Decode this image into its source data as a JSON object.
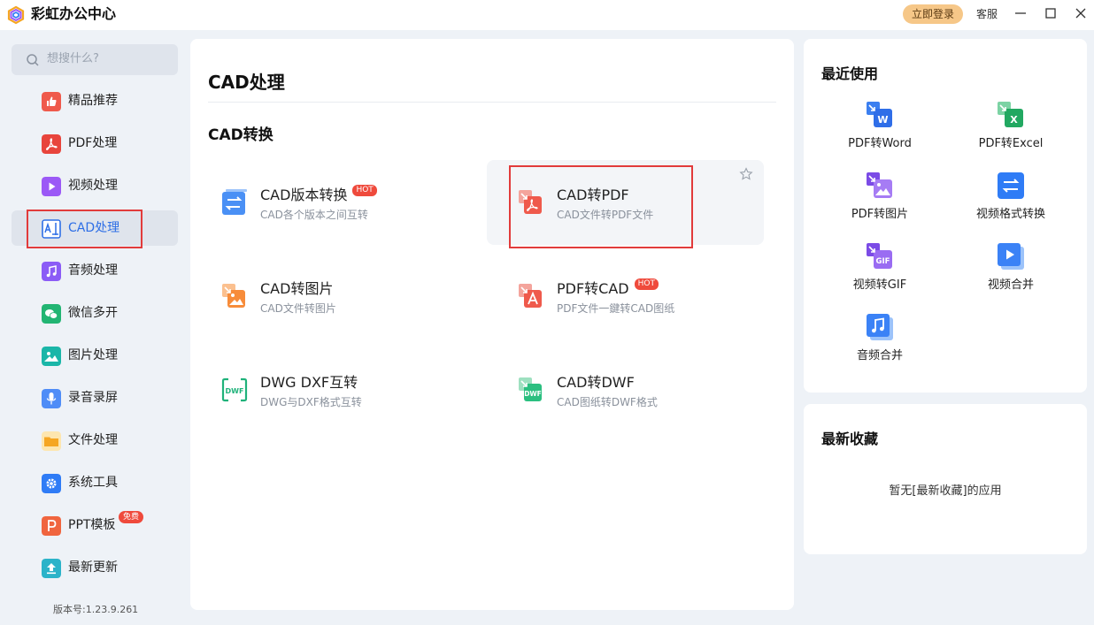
{
  "app": {
    "title": "彩虹办公中心",
    "login_label": "立即登录",
    "service_label": "客服"
  },
  "sidebar": {
    "search_placeholder": "想搜什么?",
    "items": [
      {
        "label": "精品推荐",
        "icon": "thumbs-up-icon",
        "color": "#ef5a4c"
      },
      {
        "label": "PDF处理",
        "icon": "pdf-icon",
        "color": "#e8453c"
      },
      {
        "label": "视频处理",
        "icon": "video-icon",
        "color": "#9b59f6"
      },
      {
        "label": "CAD处理",
        "icon": "cad-icon",
        "color": "#3b82f6",
        "active": true
      },
      {
        "label": "音频处理",
        "icon": "music-icon",
        "color": "#8b5cf6"
      },
      {
        "label": "微信多开",
        "icon": "wechat-icon",
        "color": "#22b573"
      },
      {
        "label": "图片处理",
        "icon": "image-icon",
        "color": "#1ab6a8"
      },
      {
        "label": "录音录屏",
        "icon": "microphone-icon",
        "color": "#4f8df7"
      },
      {
        "label": "文件处理",
        "icon": "folder-icon",
        "color": "#f5a623"
      },
      {
        "label": "系统工具",
        "icon": "gear-icon",
        "color": "#2f7cf6"
      },
      {
        "label": "PPT模板",
        "icon": "ppt-icon",
        "color": "#f0653f",
        "badge": "免费"
      },
      {
        "label": "最新更新",
        "icon": "upload-icon",
        "color": "#2bb3c9"
      }
    ],
    "version": "版本号:1.23.9.261"
  },
  "main": {
    "title": "CAD处理",
    "section": "CAD转换",
    "tools": [
      {
        "name": "CAD版本转换",
        "desc": "CAD各个版本之间互转",
        "badge": "HOT",
        "icon": "swap-icon"
      },
      {
        "name": "CAD转PDF",
        "desc": "CAD文件转PDF文件",
        "badge": "",
        "icon": "cad-to-pdf-icon"
      },
      {
        "name": "CAD转图片",
        "desc": "CAD文件转图片",
        "badge": "",
        "icon": "cad-to-image-icon"
      },
      {
        "name": "PDF转CAD",
        "desc": "PDF文件一鍵转CAD图纸",
        "badge": "HOT",
        "icon": "pdf-to-cad-icon"
      },
      {
        "name": "DWG DXF互转",
        "desc": "DWG与DXF格式互转",
        "badge": "",
        "icon": "dwg-icon"
      },
      {
        "name": "CAD转DWF",
        "desc": "CAD图纸转DWF格式",
        "badge": "",
        "icon": "dwf-icon"
      }
    ]
  },
  "recent": {
    "title": "最近使用",
    "items": [
      {
        "label": "PDF转Word",
        "icon": "pdf-to-word-icon"
      },
      {
        "label": "PDF转Excel",
        "icon": "pdf-to-excel-icon"
      },
      {
        "label": "PDF转图片",
        "icon": "pdf-to-image-icon"
      },
      {
        "label": "视频格式转换",
        "icon": "video-convert-icon"
      },
      {
        "label": "视频转GIF",
        "icon": "video-to-gif-icon"
      },
      {
        "label": "视频合并",
        "icon": "video-merge-icon"
      },
      {
        "label": "音频合并",
        "icon": "audio-merge-icon"
      }
    ]
  },
  "favorites": {
    "title": "最新收藏",
    "empty_text": "暂无[最新收藏]的应用"
  }
}
